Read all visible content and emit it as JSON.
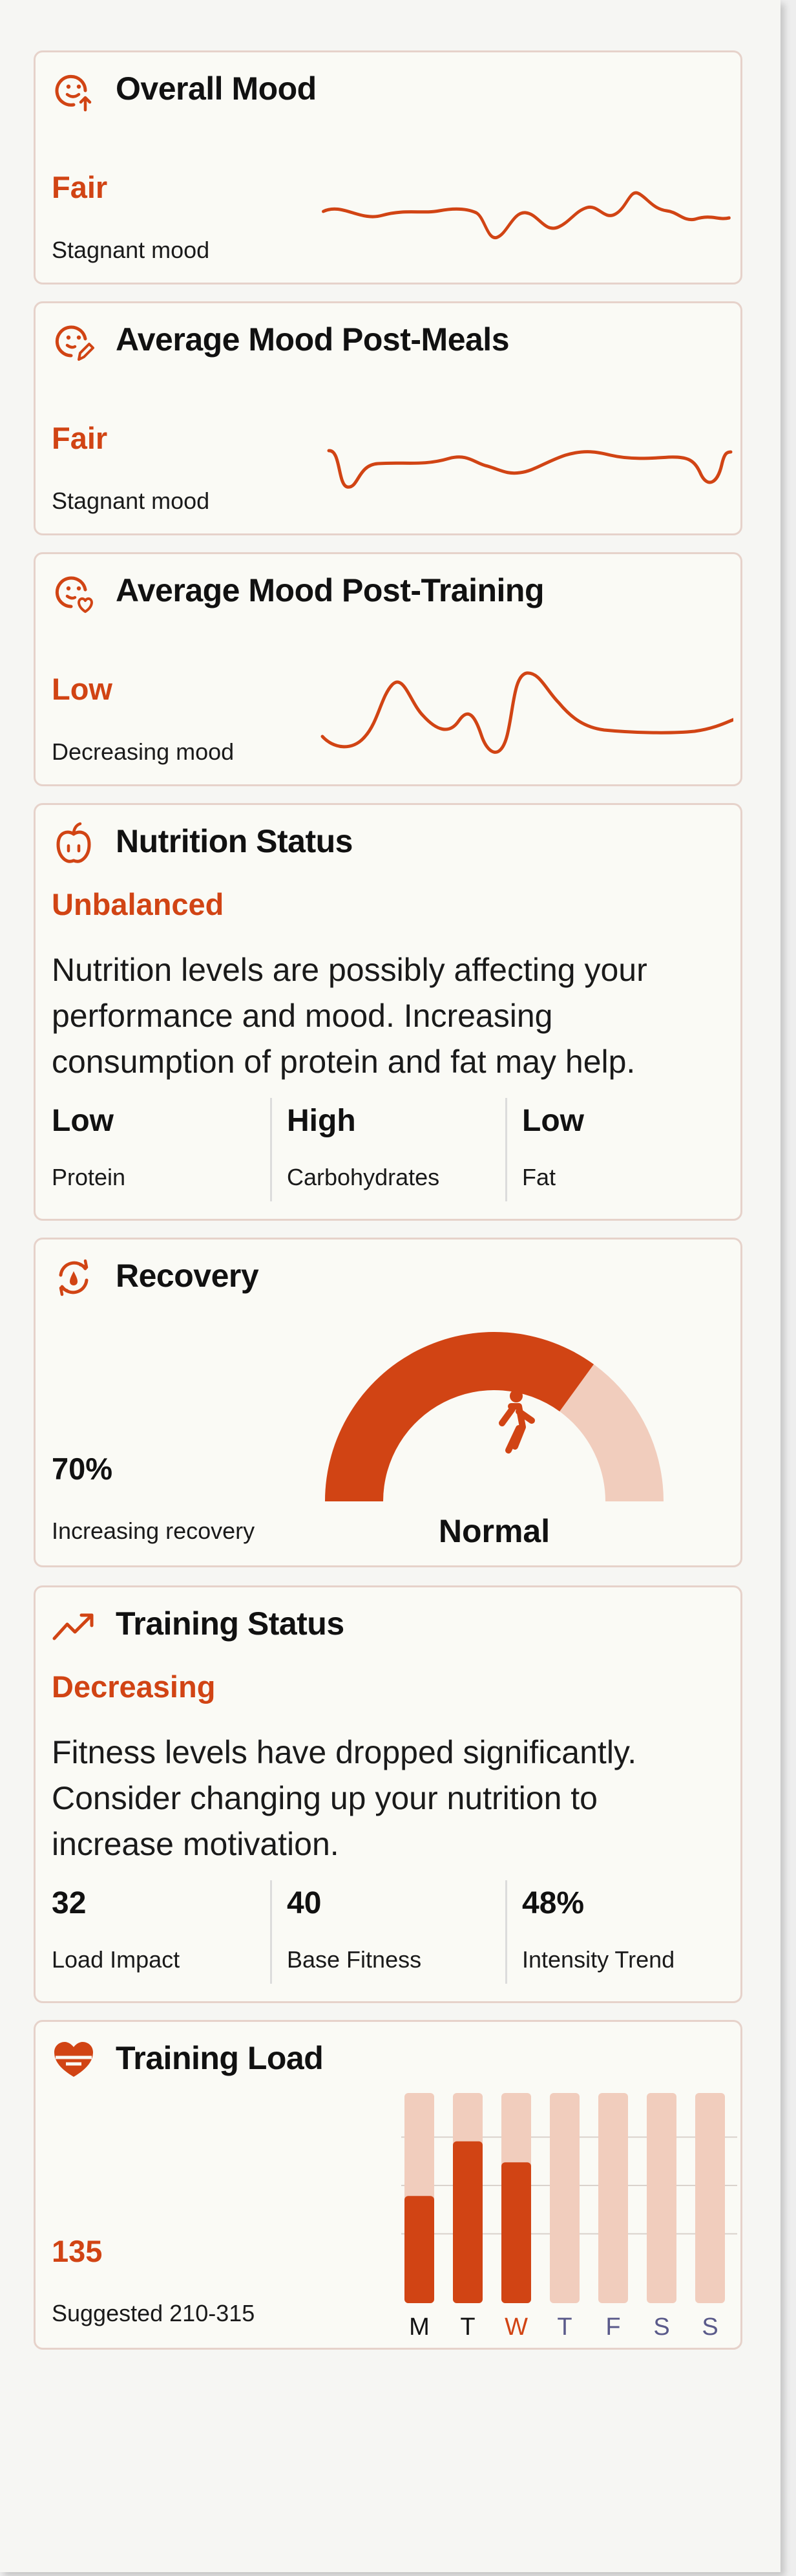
{
  "colors": {
    "accent": "#d14414",
    "accent_light": "#f1cdbd",
    "card_border": "#e6d2ca",
    "card_bg": "#fafaf5",
    "future_day": "#5a5a8a"
  },
  "cards": {
    "overall_mood": {
      "icon": "mood-up-icon",
      "title": "Overall Mood",
      "status": "Fair",
      "trend": "Stagnant mood"
    },
    "mood_post_meals": {
      "icon": "mood-edit-icon",
      "title": "Average Mood Post-Meals",
      "status": "Fair",
      "trend": "Stagnant mood"
    },
    "mood_post_training": {
      "icon": "mood-heart-icon",
      "title": "Average Mood Post-Training",
      "status": "Low",
      "trend": "Decreasing mood"
    },
    "nutrition": {
      "icon": "apple-icon",
      "title": "Nutrition Status",
      "status": "Unbalanced",
      "description": "Nutrition levels are possibly affecting your performance and mood. Increasing consumption of protein and fat may help.",
      "metrics": [
        {
          "value": "Low",
          "label": "Protein"
        },
        {
          "value": "High",
          "label": "Carbohydrates"
        },
        {
          "value": "Low",
          "label": "Fat"
        }
      ]
    },
    "recovery": {
      "icon": "recovery-icon",
      "title": "Recovery",
      "value": "70%",
      "trend": "Increasing recovery",
      "gauge_fraction": 0.7,
      "gauge_label": "Normal",
      "gauge_icon": "walking-person-icon"
    },
    "training_status": {
      "icon": "trending-up-icon",
      "title": "Training Status",
      "status": "Decreasing",
      "description": "Fitness levels have dropped significantly. Consider changing up your nutrition to increase motivation.",
      "metrics": [
        {
          "value": "32",
          "label": "Load Impact"
        },
        {
          "value": "40",
          "label": "Base Fitness"
        },
        {
          "value": "48%",
          "label": "Intensity Trend"
        }
      ]
    },
    "training_load": {
      "icon": "heart-gauge-icon",
      "title": "Training Load",
      "value": "135",
      "suggested": "Suggested 210-315",
      "days": [
        "M",
        "T",
        "W",
        "T",
        "F",
        "S",
        "S"
      ],
      "today_index": 2,
      "bar_fractions": [
        0.51,
        0.77,
        0.67,
        0,
        0,
        0,
        0
      ]
    }
  }
}
